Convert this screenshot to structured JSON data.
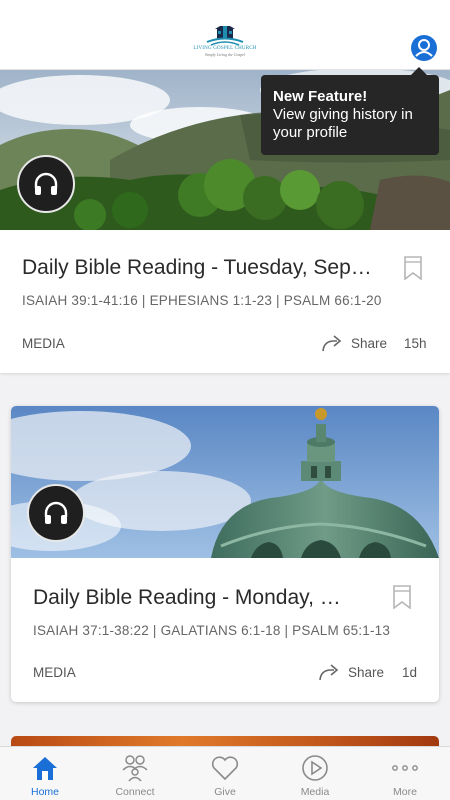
{
  "header": {
    "logo": {
      "name": "LIVING GOSPEL CHURCH",
      "tagline": "Simply Living the Gospel"
    }
  },
  "tooltip": {
    "title": "New Feature!",
    "body": "View giving history in your profile"
  },
  "feed": [
    {
      "title": "Daily Bible Reading - Tuesday, September",
      "subtitle": "ISAIAH 39:1-41:16 | EPHESIANS 1:1-23 | PSALM 66:1-20",
      "category": "MEDIA",
      "share_label": "Share",
      "age": "15h",
      "image": "mountain-landscape"
    },
    {
      "title": "Daily Bible Reading - Monday, September",
      "subtitle": "ISAIAH 37:1-38:22 | GALATIANS 6:1-18 | PSALM 65:1-13",
      "category": "MEDIA",
      "share_label": "Share",
      "age": "1d",
      "image": "green-dome"
    }
  ],
  "tabbar": {
    "items": [
      {
        "label": "Home",
        "icon": "home-icon",
        "active": true
      },
      {
        "label": "Connect",
        "icon": "people-icon",
        "active": false
      },
      {
        "label": "Give",
        "icon": "heart-icon",
        "active": false
      },
      {
        "label": "Media",
        "icon": "play-icon",
        "active": false
      },
      {
        "label": "More",
        "icon": "more-icon",
        "active": false
      }
    ]
  },
  "colors": {
    "accent": "#1a6fd6",
    "tooltip_bg": "#262626",
    "logo_teal": "#1e8fb0"
  }
}
